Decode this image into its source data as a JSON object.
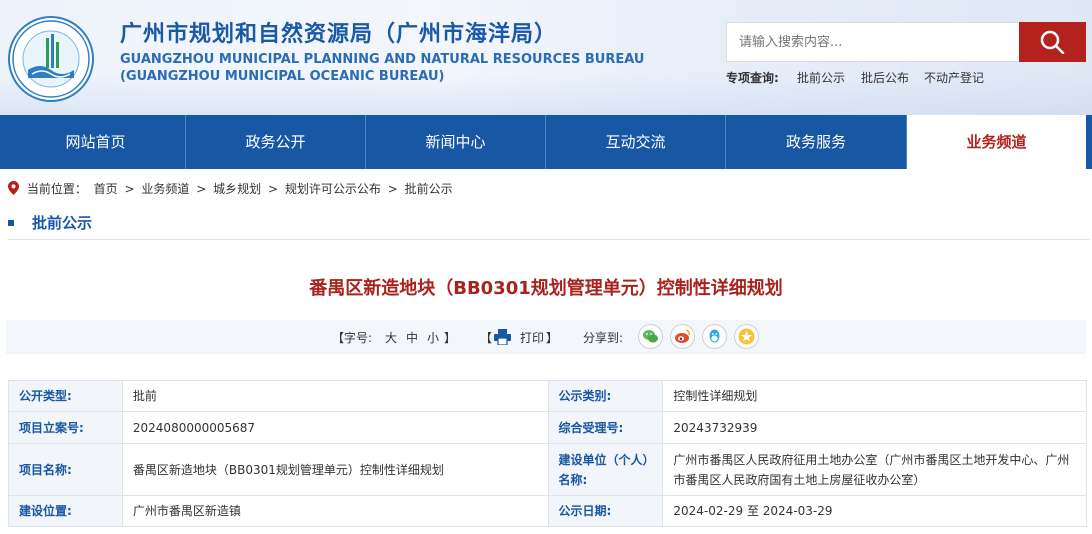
{
  "header": {
    "title": "广州市规划和自然资源局（广州市海洋局）",
    "title_en_line1": "GUANGZHOU MUNICIPAL PLANNING AND NATURAL RESOURCES BUREAU",
    "title_en_line2": "(GUANGZHOU MUNICIPAL OCEANIC BUREAU)",
    "logo_icon": "bureau-seal-icon",
    "search_placeholder": "请输入搜索内容...",
    "search_icon": "search-icon",
    "quick_label": "专项查询:",
    "quick_links": [
      "批前公示",
      "批后公布",
      "不动产登记"
    ]
  },
  "nav": {
    "items": [
      "网站首页",
      "政务公开",
      "新闻中心",
      "互动交流",
      "政务服务",
      "业务频道"
    ],
    "active_index": 5
  },
  "breadcrumb": {
    "prefix": "当前位置：",
    "items": [
      "首页",
      "业务频道",
      "城乡规划",
      "规划许可公示公布",
      "批前公示"
    ],
    "separator": ">"
  },
  "section": {
    "title": "批前公示"
  },
  "article": {
    "title": "番禺区新造地块（BB0301规划管理单元）控制性详细规划"
  },
  "toolbar": {
    "font_label": "【字号:",
    "font_large": "大",
    "font_medium": "中",
    "font_small": "小",
    "font_close": "】",
    "print_open": "【",
    "print_label": "打印",
    "print_close": "】",
    "share_label": "分享到:",
    "share_icons": [
      "wechat-icon",
      "weibo-icon",
      "qq-icon",
      "qzone-icon"
    ]
  },
  "info": {
    "rows": [
      [
        {
          "label": "公开类型:",
          "value": "批前"
        },
        {
          "label": "公示类别:",
          "value": "控制性详细规划"
        }
      ],
      [
        {
          "label": "项目立案号:",
          "value": "2024080000005687"
        },
        {
          "label": "综合受理号:",
          "value": "20243732939"
        }
      ],
      [
        {
          "label": "项目名称:",
          "value": "番禺区新造地块（BB0301规划管理单元）控制性详细规划"
        },
        {
          "label": "建设单位（个人）名称:",
          "value": "广州市番禺区人民政府征用土地办公室（广州市番禺区土地开发中心、广州市番禺区人民政府国有土地上房屋征收办公室）"
        }
      ],
      [
        {
          "label": "建设位置:",
          "value": "广州市番禺区新造镇"
        },
        {
          "label": "公示日期:",
          "value": "2024-02-29 至 2024-03-29"
        }
      ]
    ]
  },
  "colors": {
    "brand_blue": "#1857a4",
    "accent_red": "#b3221c",
    "title_red": "#a8231e"
  }
}
